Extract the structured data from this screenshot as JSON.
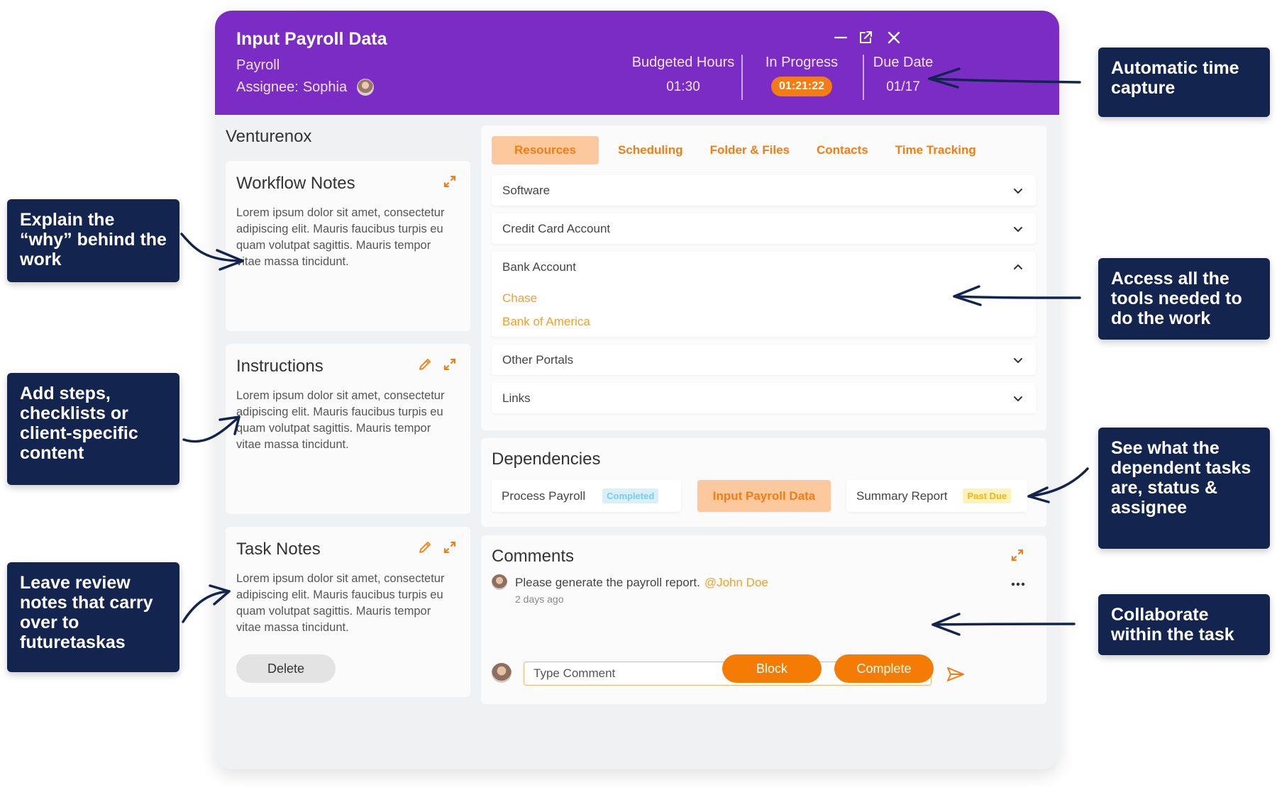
{
  "header": {
    "title": "Input Payroll Data",
    "subtitle": "Payroll",
    "assignee_label": "Assignee:",
    "assignee_name": "Sophia",
    "budgeted_label": "Budgeted Hours",
    "budgeted_value": "01:30",
    "status_label": "In Progress",
    "timer_value": "01:21:22",
    "due_label": "Due Date",
    "due_value": "01/17",
    "controls": [
      "minimize-icon",
      "popout-icon",
      "close-icon"
    ]
  },
  "client": "Venturenox",
  "cards": [
    {
      "title": "Workflow Notes",
      "body": "Lorem ipsum dolor sit amet, consectetur adipiscing elit. Mauris faucibus turpis eu quam volutpat sagittis. Mauris tempor vitae massa tincidunt."
    },
    {
      "title": "Instructions",
      "body": "Lorem ipsum dolor sit amet, consectetur adipiscing elit. Mauris faucibus turpis eu quam volutpat sagittis. Mauris tempor vitae massa tincidunt."
    },
    {
      "title": "Task Notes",
      "body": "Lorem ipsum dolor sit amet, consectetur adipiscing elit. Mauris faucibus turpis eu quam volutpat sagittis. Mauris tempor vitae massa tincidunt."
    }
  ],
  "tabs": [
    "Resources",
    "Scheduling",
    "Folder & Files",
    "Contacts",
    "Time Tracking"
  ],
  "resources": {
    "software": "Software",
    "credit_card": "Credit Card Account",
    "bank_account": "Bank Account",
    "bank_links": [
      "Chase",
      "Bank of America"
    ],
    "other_portals": "Other Portals",
    "links": "Links"
  },
  "dependencies": {
    "title": "Dependencies",
    "items": [
      {
        "name": "Process Payroll",
        "status": "Completed"
      },
      {
        "name": "Input Payroll Data",
        "status": ""
      },
      {
        "name": "Summary Report",
        "status": "Past Due"
      }
    ]
  },
  "comments": {
    "title": "Comments",
    "items": [
      {
        "text": "Please generate the payroll report.",
        "mention": "@John Doe",
        "time": "2 days ago"
      }
    ],
    "placeholder": "Type Comment"
  },
  "footer": {
    "delete": "Delete",
    "block": "Block",
    "complete": "Complete"
  },
  "callouts": {
    "time_capture": "Automatic time capture",
    "why": "Explain the “why” behind the work",
    "steps": "Add steps, checklists or client-specific content",
    "review": "Leave review notes that carry over to futuretaskas",
    "tools": "Access all the tools needed to do the work",
    "dependent": "See what the dependent tasks are, status & assignee",
    "collaborate": "Collaborate within the task"
  },
  "colors": {
    "header": "#7a2cc5",
    "accent": "#f47c14",
    "callout": "#13254f",
    "link": "#f2a02a"
  }
}
